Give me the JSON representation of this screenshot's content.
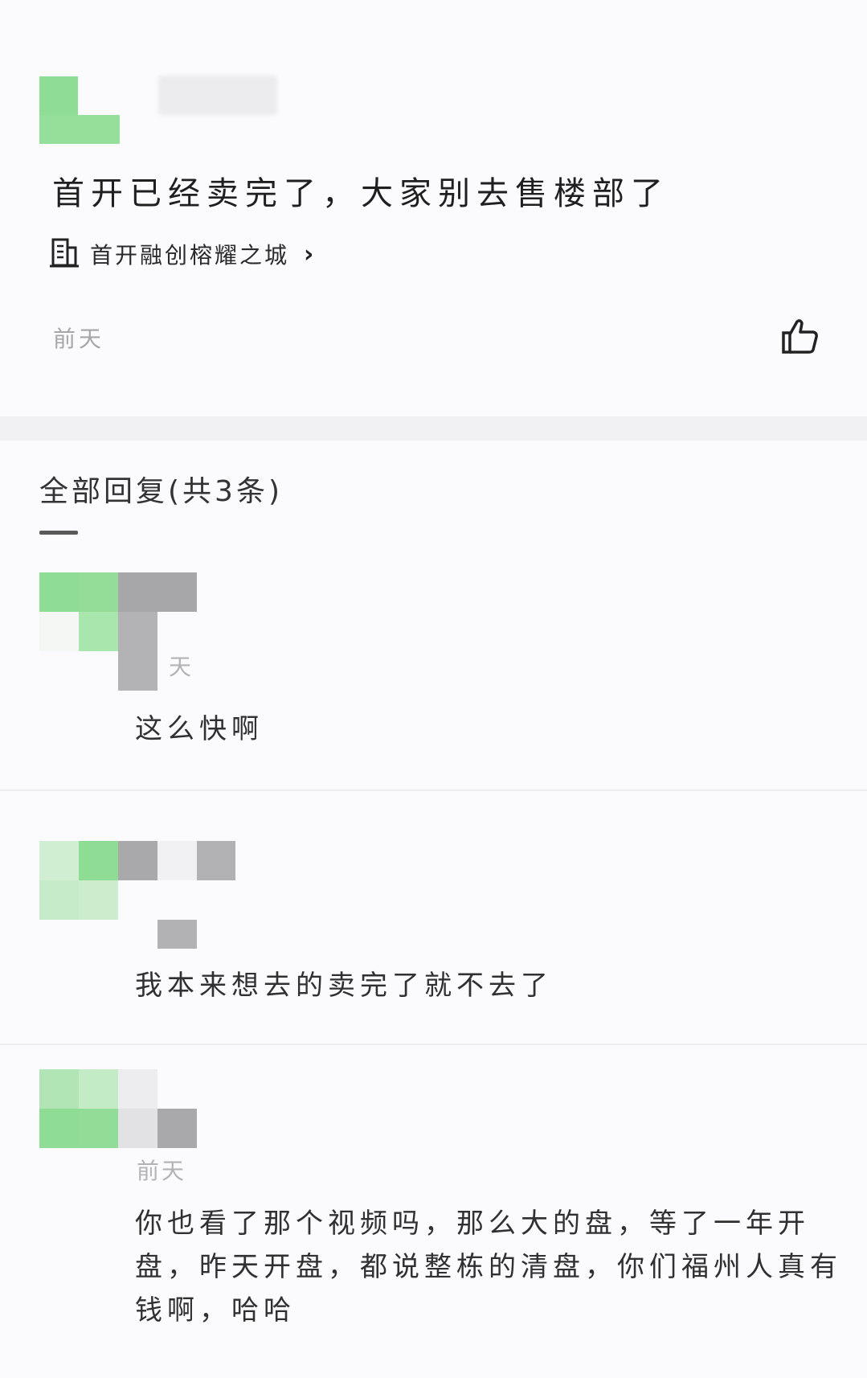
{
  "post": {
    "text": "首开已经卖完了，大家别去售楼部了",
    "project_name": "首开融创榕耀之城",
    "chevron": "›",
    "time": "前天",
    "like_icon": "thumbs-up-icon"
  },
  "replies": {
    "header": "全部回复(共3条)"
  },
  "comments": [
    {
      "time": "天",
      "text": "这么快啊"
    },
    {
      "time": "",
      "text": "我本来想去的卖完了就不去了"
    },
    {
      "time": "前天",
      "text": "你也看了那个视频吗，那么大的盘，等了一年开盘，昨天开盘，都说整栋的清盘，你们福州人真有钱啊，哈哈"
    }
  ],
  "colors": {
    "avatar_green": "#8fdc95",
    "avatar_gray": "#a9a9ab",
    "divider": "#ededf0"
  }
}
